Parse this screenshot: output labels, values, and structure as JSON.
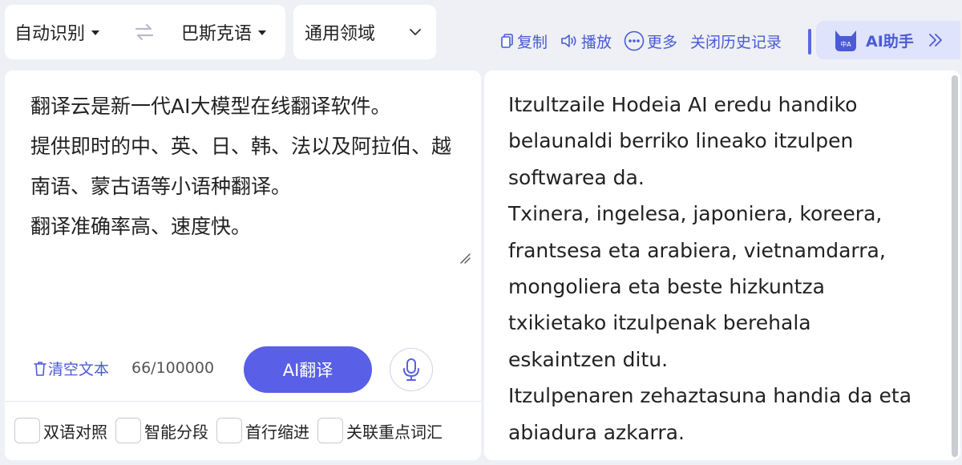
{
  "lang_bar": {
    "source_lang": "自动识别",
    "target_lang": "巴斯克语"
  },
  "domain": {
    "selected": "通用领域"
  },
  "toolbar": {
    "copy": "复制",
    "play": "播放",
    "more": "更多",
    "close_history": "关闭历史记录",
    "ai_assistant": "AI助手"
  },
  "source": {
    "text": "翻译云是新一代AI大模型在线翻译软件。\n提供即时的中、英、日、韩、法以及阿拉伯、越南语、蒙古语等小语种翻译。\n翻译准确率高、速度快。",
    "clear_label": "清空文本",
    "counter": "66/100000",
    "translate_label": "AI翻译"
  },
  "options": [
    {
      "label": "双语对照"
    },
    {
      "label": "智能分段"
    },
    {
      "label": "首行缩进"
    },
    {
      "label": "关联重点词汇"
    }
  ],
  "target": {
    "text": "Itzultzaile Hodeia AI eredu handiko\nbelaunaldi berriko lineako itzulpen\nsoftwarea da.\nTxinera, ingelesa, japoniera, koreera,\nfrantsesa eta arabiera, vietnamdarra,\nmongoliera eta beste hizkuntza\ntxikietako itzulpenak berehala\neskaintzen ditu.\nItzulpenaren zehaztasuna handia da eta\nabiadura azkarra."
  },
  "colors": {
    "accent": "#5a5fe8",
    "link": "#4a5bd4",
    "background": "#eef0f5"
  }
}
